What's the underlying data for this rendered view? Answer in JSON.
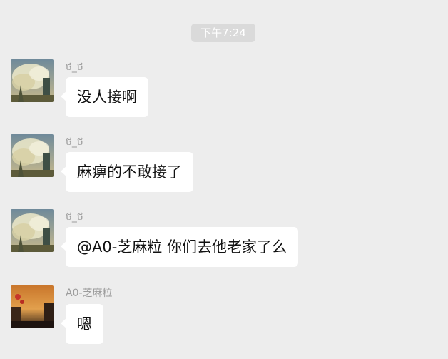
{
  "timestamp": "下午7:24",
  "messages": [
    {
      "sender": "ថ_ថ",
      "text": "没人接啊",
      "avatar": "tree-sky-avatar"
    },
    {
      "sender": "ថ_ថ",
      "text": "麻痹的不敢接了",
      "avatar": "tree-sky-avatar"
    },
    {
      "sender": "ថ_ថ",
      "text": "@A0-芝麻粒 你们去他老家了么",
      "avatar": "tree-sky-avatar"
    },
    {
      "sender": "A0-芝麻粒",
      "text": "嗯",
      "avatar": "sunset-street-avatar"
    }
  ],
  "colors": {
    "background": "#ededed",
    "bubble": "#ffffff",
    "sender_text": "#9b9b9b",
    "time_pill": "#dadada"
  }
}
